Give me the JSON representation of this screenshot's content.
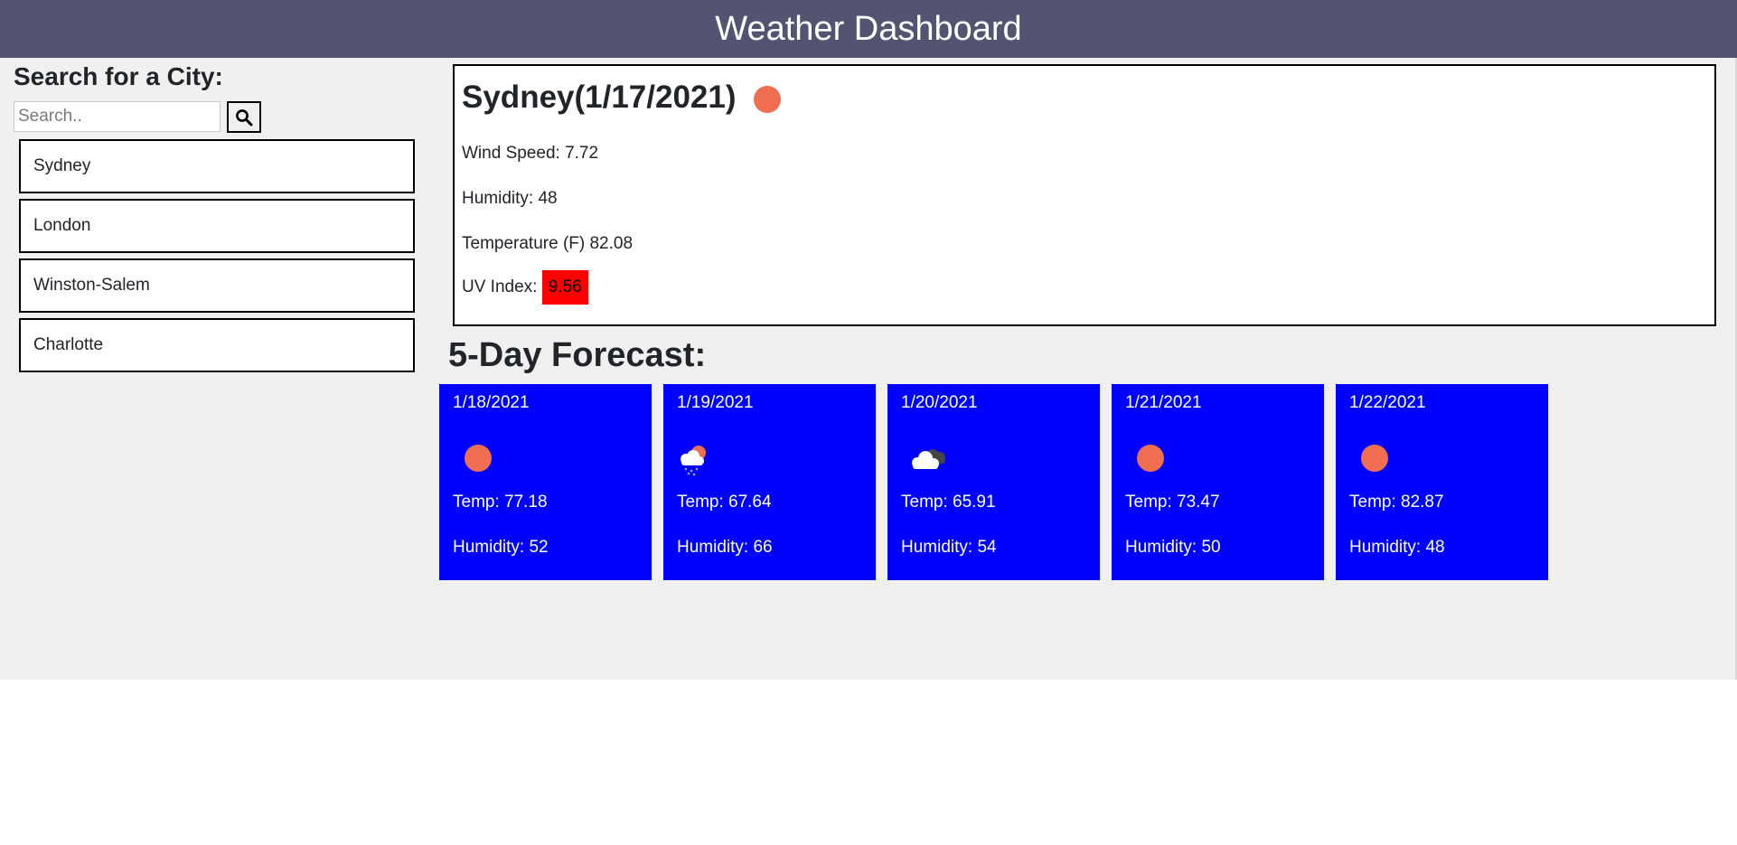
{
  "header": {
    "title": "Weather Dashboard"
  },
  "sidebar": {
    "title": "Search for a City:",
    "search": {
      "placeholder": "Search..",
      "value": ""
    },
    "search_icon": "search-icon",
    "cities": [
      "Sydney",
      "London",
      "Winston-Salem",
      "Charlotte"
    ]
  },
  "current": {
    "title": "Sydney(1/17/2021)",
    "icon": "sun-icon",
    "wind_speed": "Wind Speed: 7.72",
    "humidity": "Humidity: 48",
    "temperature": "Temperature (F) 82.08",
    "uv_label": "UV Index:",
    "uv_value": "9.56"
  },
  "forecast": {
    "title": "5-Day Forecast:",
    "days": [
      {
        "date": "1/18/2021",
        "icon": "sun-icon",
        "temp": "Temp: 77.18",
        "humidity": "Humidity: 52"
      },
      {
        "date": "1/19/2021",
        "icon": "rain-sun-icon",
        "temp": "Temp: 67.64",
        "humidity": "Humidity: 66"
      },
      {
        "date": "1/20/2021",
        "icon": "cloud-icon",
        "temp": "Temp: 65.91",
        "humidity": "Humidity: 54"
      },
      {
        "date": "1/21/2021",
        "icon": "sun-icon",
        "temp": "Temp: 73.47",
        "humidity": "Humidity: 50"
      },
      {
        "date": "1/22/2021",
        "icon": "sun-icon",
        "temp": "Temp: 82.87",
        "humidity": "Humidity: 48"
      }
    ]
  },
  "colors": {
    "header_bg": "#535471",
    "page_bg": "#f0f0f0",
    "card_bg": "#0000ff",
    "uv_bg": "#ff0000",
    "sun": "#ee6e4f"
  }
}
